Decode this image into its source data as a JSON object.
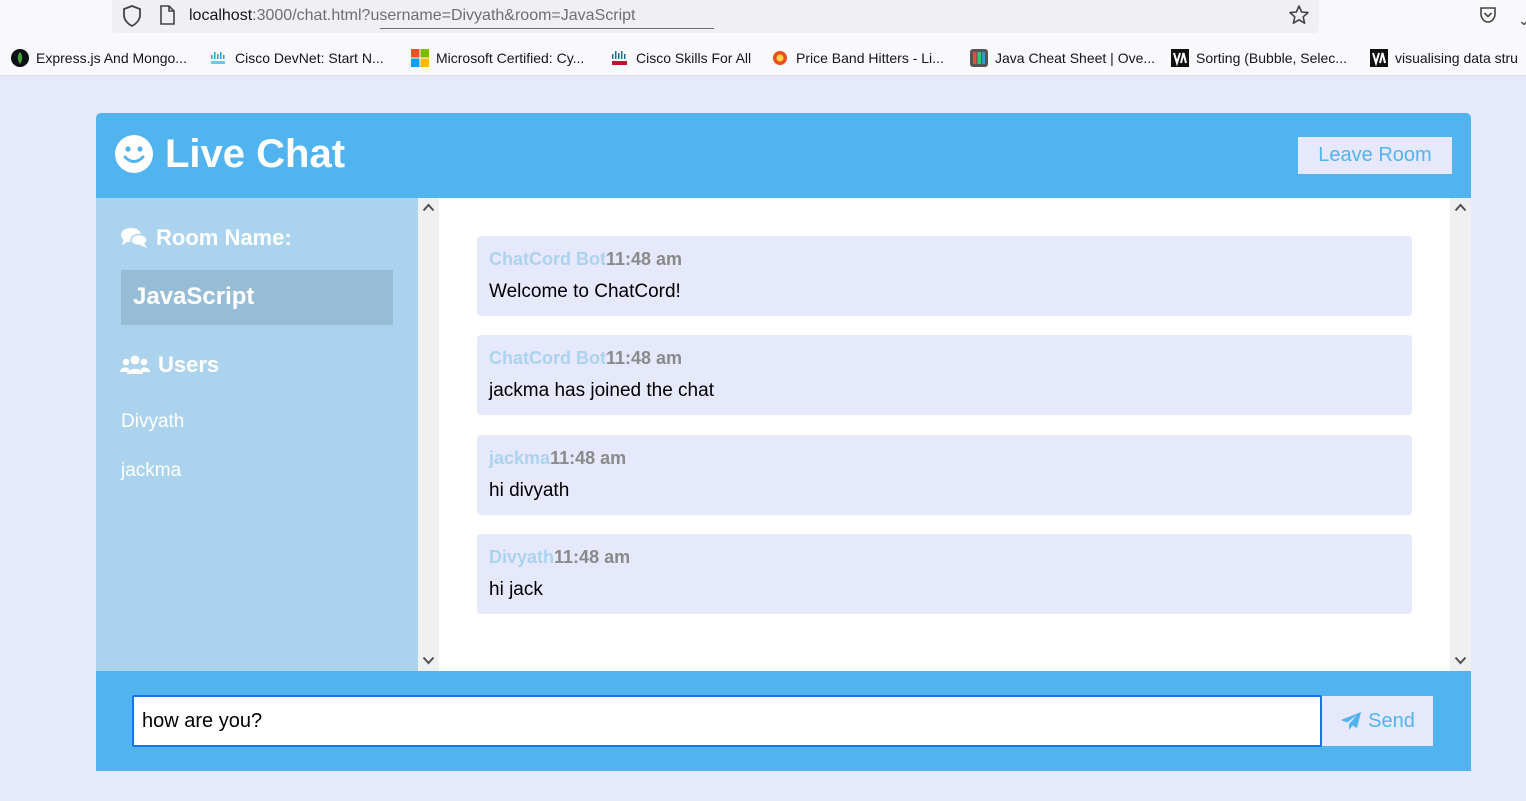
{
  "browser": {
    "url_host": "localhost",
    "url_rest": ":3000/chat.html?username=Divyath&room=JavaScript",
    "bookmarks": [
      {
        "label": "Express.js And Mongo...",
        "icon": "mongodb-leaf-icon"
      },
      {
        "label": "Cisco DevNet: Start N...",
        "icon": "cisco-icon"
      },
      {
        "label": "Microsoft Certified: Cy...",
        "icon": "microsoft-icon"
      },
      {
        "label": "Cisco Skills For All",
        "icon": "cisco-icon"
      },
      {
        "label": "Price Band Hitters - Li...",
        "icon": "price-band-icon"
      },
      {
        "label": "Java Cheat Sheet | Ove...",
        "icon": "java-cheat-icon"
      },
      {
        "label": "Sorting (Bubble, Selec...",
        "icon": "visualgo-icon"
      },
      {
        "label": "visualising data stru",
        "icon": "visualgo-icon"
      }
    ]
  },
  "header": {
    "title": "Live Chat",
    "leave_label": "Leave Room"
  },
  "sidebar": {
    "room_heading": "Room Name:",
    "room_name": "JavaScript",
    "users_heading": "Users",
    "users": [
      "Divyath",
      "jackma"
    ]
  },
  "messages": [
    {
      "user": "ChatCord Bot",
      "time": "11:48 am",
      "text": "Welcome to ChatCord!"
    },
    {
      "user": "ChatCord Bot",
      "time": "11:48 am",
      "text": "jackma has joined the chat"
    },
    {
      "user": "jackma",
      "time": "11:48 am",
      "text": "hi divyath"
    },
    {
      "user": "Divyath",
      "time": "11:48 am",
      "text": "hi jack"
    }
  ],
  "form": {
    "input_value": "how are you?",
    "send_label": "Send"
  },
  "colors": {
    "accent": "#52b4ee",
    "light_accent": "#acd3ee",
    "bg": "#e6e8fb"
  }
}
